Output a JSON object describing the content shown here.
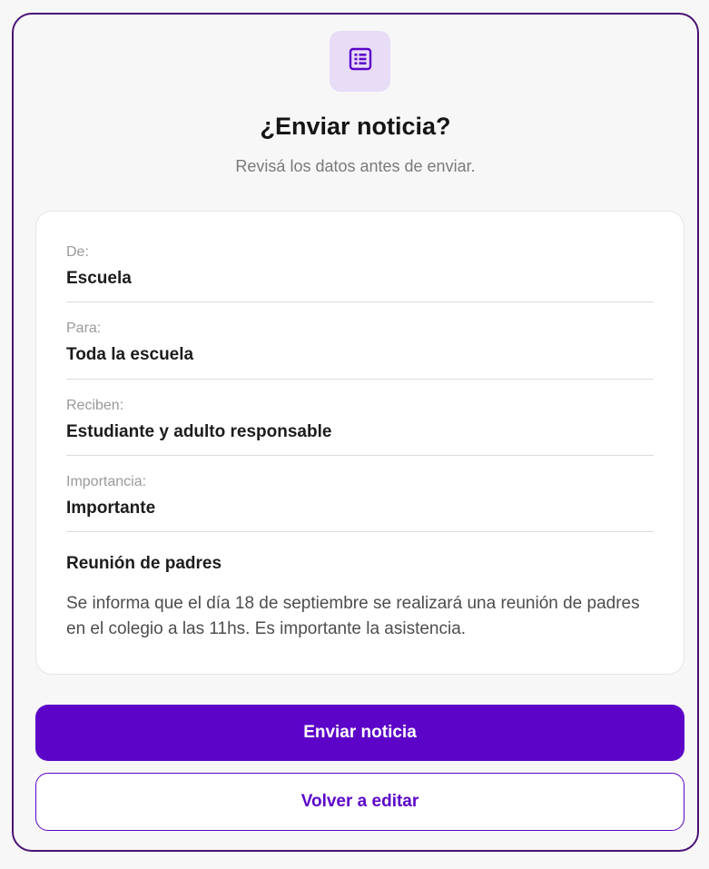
{
  "dialog": {
    "icon": "document-list-icon",
    "title": "¿Enviar noticia?",
    "subtitle": "Revisá los datos antes de enviar."
  },
  "summary": {
    "from": {
      "label": "De:",
      "value": "Escuela"
    },
    "to": {
      "label": "Para:",
      "value": "Toda la escuela"
    },
    "recipients": {
      "label": "Reciben:",
      "value": "Estudiante y adulto responsable"
    },
    "importance": {
      "label": "Importancia:",
      "value": "Importante"
    },
    "notice_title": "Reunión de padres",
    "notice_body": "Se informa que el día 18 de septiembre se realizará una reunión de padres en el colegio a las 11hs. Es importante la asistencia."
  },
  "actions": {
    "send_label": "Enviar noticia",
    "edit_label": "Volver a editar"
  },
  "colors": {
    "accent": "#5c05c8",
    "icon_badge_bg": "#e8dcf7",
    "dialog_border": "#4a1375"
  }
}
